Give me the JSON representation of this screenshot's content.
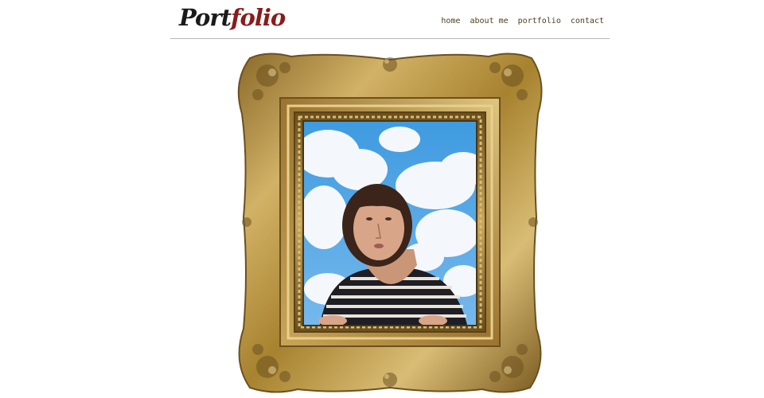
{
  "logo": {
    "part_a": "Port",
    "part_b": "folio"
  },
  "nav": {
    "items": [
      {
        "label": "home"
      },
      {
        "label": "about me"
      },
      {
        "label": "portfolio"
      },
      {
        "label": "contact"
      }
    ]
  },
  "colors": {
    "logo_dark": "#1a1a1a",
    "logo_accent": "#8a1b1b",
    "nav_text": "#4b3f1c",
    "divider": "#b7b7b7",
    "frame_gold": "#b8913c",
    "sky_blue": "#3f9be0"
  },
  "hero": {
    "image_name": "framed-portrait-icon"
  }
}
